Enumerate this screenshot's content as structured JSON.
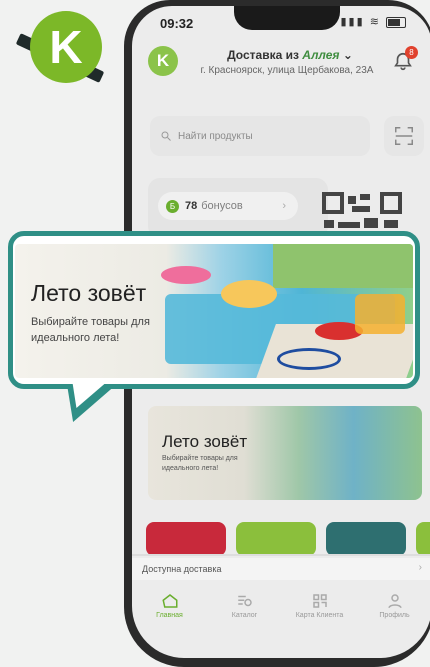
{
  "brand": {
    "logo_letter": "K",
    "accent": "#7cb828"
  },
  "status": {
    "time": "09:32"
  },
  "header": {
    "title_prefix": "Доставка из",
    "store_name": "Аллея",
    "address": "г. Красноярск, улица Щербакова, 23А",
    "notification_count": "8"
  },
  "search": {
    "placeholder": "Найти продукты"
  },
  "bonus": {
    "value": "78",
    "unit": "бонусов"
  },
  "banner": {
    "title": "Лето зовёт",
    "subtitle": "Выбирайте товары для идеального лета!"
  },
  "banner_small": {
    "title": "Лето зовёт",
    "subtitle": "Выбирайте товары для идеального лета!"
  },
  "category_tiles": [
    {
      "color": "#c8293b"
    },
    {
      "color": "#8bbf3c"
    },
    {
      "color": "#2e6f70"
    },
    {
      "color": "#8bbf3c"
    }
  ],
  "delivery": {
    "label": "Доступна доставка"
  },
  "nav": {
    "items": [
      {
        "label": "Главная",
        "icon": "home-icon",
        "active": true
      },
      {
        "label": "Каталог",
        "icon": "catalog-search-icon"
      },
      {
        "label": "Карта Клиента",
        "icon": "barcode-card-icon"
      },
      {
        "label": "Профиль",
        "icon": "person-icon"
      }
    ]
  }
}
